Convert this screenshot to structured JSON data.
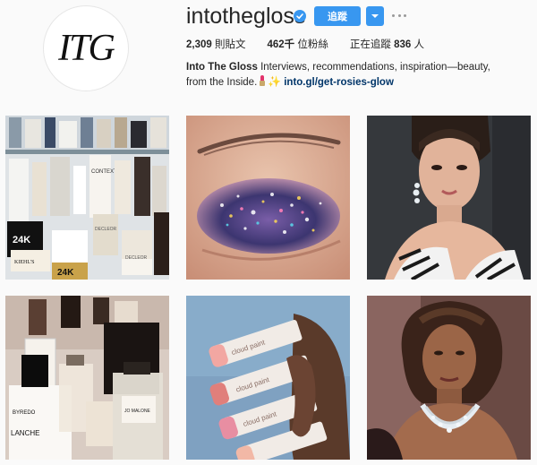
{
  "profile": {
    "avatar_text": "ITG",
    "username": "intothegloss",
    "follow_label": "追蹤",
    "stats": {
      "posts_count": "2,309",
      "posts_label": "則貼文",
      "followers_count": "462千",
      "followers_label": "位粉絲",
      "following_prefix": "正在追蹤",
      "following_count": "836",
      "following_suffix": "人"
    },
    "bio": {
      "name": "Into The Gloss",
      "text": "Interviews, recommendations, inspiration—beauty, from the Inside.",
      "link": "into.gl/get-rosies-glow"
    }
  },
  "grid": {
    "posts": [
      {
        "alt_name": "beauty-products-shelf"
      },
      {
        "alt_name": "glitter-eye-makeup"
      },
      {
        "alt_name": "portrait-woman-earrings"
      },
      {
        "alt_name": "perfume-bottles"
      },
      {
        "alt_name": "hand-holding-tubes"
      },
      {
        "alt_name": "portrait-woman-necklace"
      }
    ],
    "product_labels": {
      "context": "CONTEXT",
      "kiehls": "KIEHL'S",
      "decleor": "DECLEOR",
      "gold_24k": "24K",
      "byredo": "BYREDO",
      "blanche": "LANCHE",
      "jo_malone": "JO MALONE",
      "cloud_paint": "cloud paint"
    }
  },
  "colors": {
    "accent": "#3897f0",
    "link": "#003569",
    "background": "#fafafa"
  },
  "icons": {
    "verified": "verified-badge-icon",
    "dropdown": "chevron-down-icon",
    "more": "more-options-icon"
  }
}
